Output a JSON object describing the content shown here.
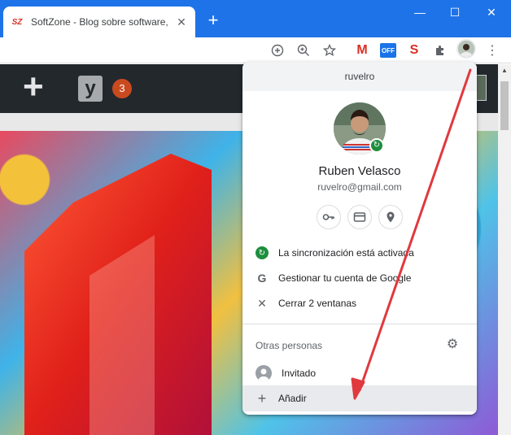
{
  "tab": {
    "favicon": "SZ",
    "title": "SoftZone - Blog sobre software, t",
    "close": "✕"
  },
  "new_tab": "+",
  "window": {
    "minimize": "—",
    "maximize": "☐",
    "close": "✕"
  },
  "toolbar": {
    "icons": [
      "add-circle-icon",
      "zoom-icon",
      "star-icon",
      "gmail-icon",
      "off-extension-icon",
      "s-extension-icon",
      "puzzle-icon",
      "profile-avatar-icon",
      "kebab-menu-icon"
    ],
    "gmail": "M",
    "off": "OFF",
    "s_ext": "S",
    "menu": "⋮"
  },
  "wpbar": {
    "plus": "+",
    "yoast": "y",
    "badge": "3"
  },
  "profile": {
    "header": "ruvelro",
    "name": "Ruben Velasco",
    "email": "ruvelro@gmail.com",
    "quick_icons": [
      "key-icon",
      "card-icon",
      "location-icon"
    ]
  },
  "menu": {
    "sync": "La sincronización está activada",
    "manage": "Gestionar tu cuenta de Google",
    "close_windows": "Cerrar 2 ventanas"
  },
  "others": {
    "title": "Otras personas",
    "guest": "Invitado",
    "add": "Añadir"
  },
  "colors": {
    "titlebar": "#1e73e8",
    "annotation_arrow": "#e0393e",
    "sync_green": "#1e8e3e"
  }
}
